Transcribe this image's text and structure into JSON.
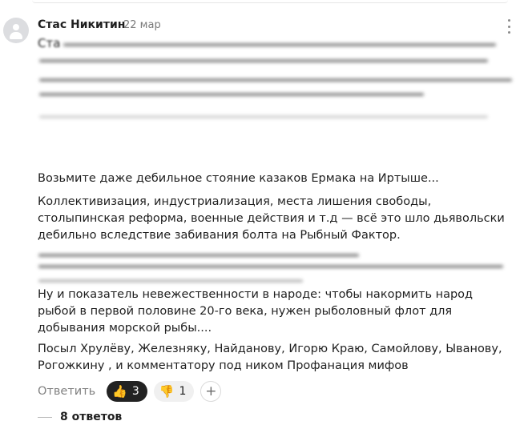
{
  "comment": {
    "author": "Стас Никитин",
    "date": "22 мар",
    "text_start": "Ста",
    "paragraphs": [
      "Возьмите даже дебильное стояние казаков Ермака на Иртыше...",
      "Коллективизация, индустриализация, места лишения свободы, столыпинская реформа, военные действия и т.д — всё это шло дьявольски дебильно вследствие забивания болта на Рыбный Фактор.",
      "Ну и показатель невежественности в народе: чтобы накормить народ рыбой в первой половине 20-го века, нужен рыболовный флот для добывания морской рыбы....",
      "Посыл Хрулёву, Железняку, Найданову, Игорю Краю, Самойлову, Ыванову, Рогожкину , и комментатору под ником Профанация мифов"
    ]
  },
  "actions": {
    "reply_label": "Ответить",
    "reactions": [
      {
        "emoji": "👍",
        "icon": "thumbs-up-icon",
        "count": "3"
      },
      {
        "emoji": "👎",
        "icon": "thumbs-down-icon",
        "count": "1"
      }
    ],
    "add_reaction_label": "+"
  },
  "replies": {
    "label": "8 ответов"
  }
}
